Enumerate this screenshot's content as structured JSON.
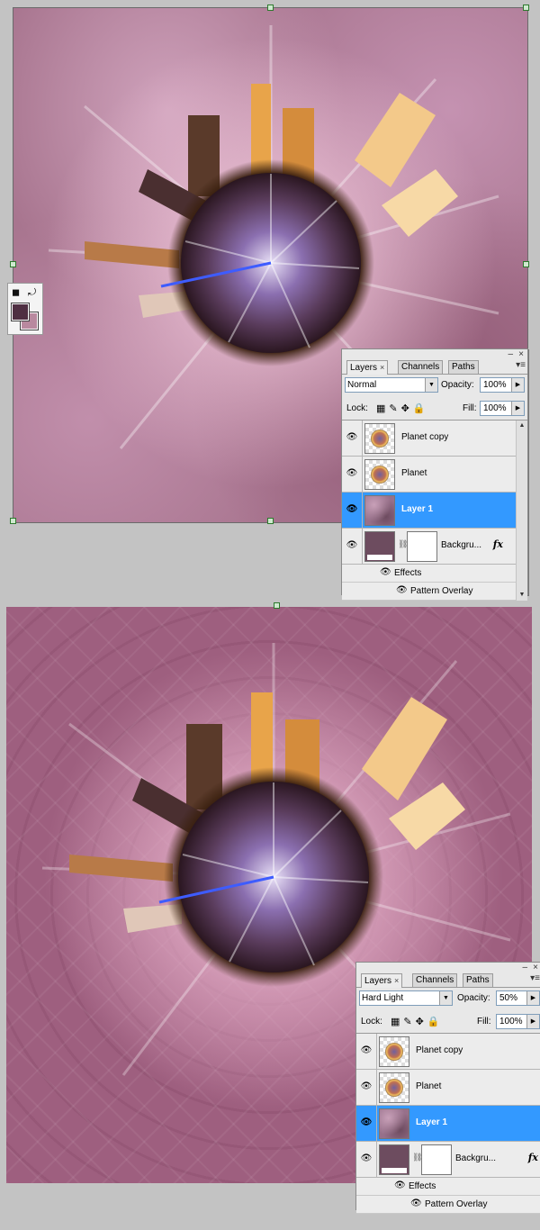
{
  "step1": {
    "panel": {
      "tabs": [
        "Layers",
        "Channels",
        "Paths"
      ],
      "close_glyph": "×",
      "blend_mode": "Normal",
      "opacity_label": "Opacity:",
      "opacity_value": "100%",
      "lock_label": "Lock:",
      "fill_label": "Fill:",
      "fill_value": "100%",
      "layers": [
        "Planet copy",
        "Planet",
        "Layer 1",
        "Backgru..."
      ],
      "effects_label": "Effects",
      "pattern_overlay_label": "Pattern Overlay"
    }
  },
  "step2": {
    "panel": {
      "tabs": [
        "Layers",
        "Channels",
        "Paths"
      ],
      "close_glyph": "×",
      "blend_mode": "Hard Light",
      "opacity_label": "Opacity:",
      "opacity_value": "50%",
      "lock_label": "Lock:",
      "fill_label": "Fill:",
      "fill_value": "100%",
      "layers": [
        "Planet copy",
        "Planet",
        "Layer 1",
        "Backgru..."
      ],
      "effects_label": "Effects",
      "pattern_overlay_label": "Pattern Overlay"
    }
  },
  "icons": {
    "visibility": "eye-icon",
    "lock_transparency": "checkerboard-icon",
    "lock_image": "brush-icon",
    "lock_position": "move-icon",
    "lock_all": "padlock-icon",
    "link": "chain-icon",
    "fx": "fx-icon"
  },
  "colors": {
    "selected_layer": "#3399ff",
    "foreground_swatch": "#4f2f42",
    "background_swatch": "#b9899f",
    "canvas_pink": "#a8758f"
  }
}
